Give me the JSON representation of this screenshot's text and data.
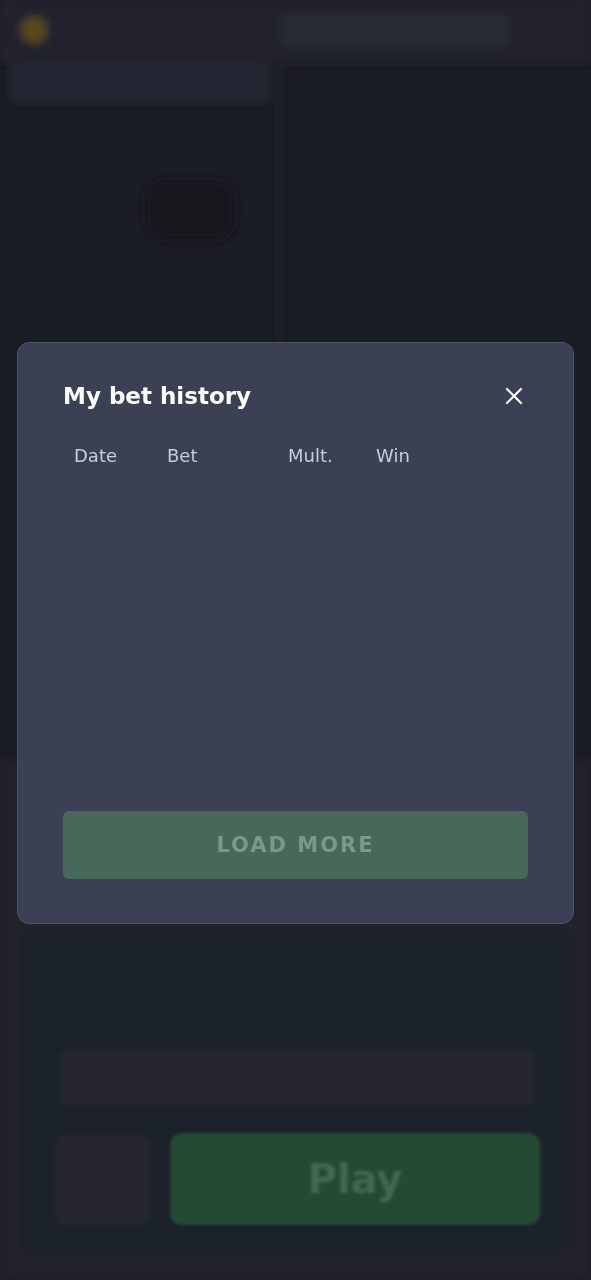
{
  "dialog": {
    "title": "My bet history",
    "columns": [
      "Date",
      "Bet",
      "Mult.",
      "Win"
    ],
    "load_more": {
      "label": "LOAD MORE",
      "disabled": true
    }
  },
  "background": {
    "play_button": {
      "label": "Play"
    }
  }
}
